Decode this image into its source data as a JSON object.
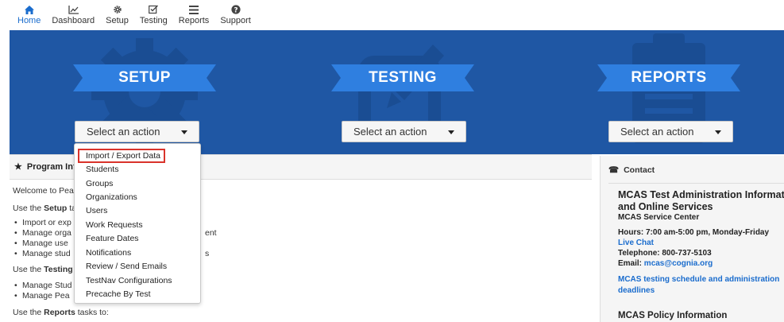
{
  "nav": {
    "items": [
      {
        "label": "Home",
        "icon": "home-icon"
      },
      {
        "label": "Dashboard",
        "icon": "chart-icon"
      },
      {
        "label": "Setup",
        "icon": "gear-icon"
      },
      {
        "label": "Testing",
        "icon": "checkbox-icon"
      },
      {
        "label": "Reports",
        "icon": "report-icon"
      },
      {
        "label": "Support",
        "icon": "help-icon"
      }
    ]
  },
  "banner": {
    "color": "#1f57a4",
    "ribbon_color": "#2f7fe0",
    "sections": [
      {
        "title": "SETUP",
        "select_label": "Select an action",
        "icon": "gear-icon"
      },
      {
        "title": "TESTING",
        "select_label": "Select an action",
        "icon": "edit-icon"
      },
      {
        "title": "REPORTS",
        "select_label": "Select an action",
        "icon": "clipboard-icon"
      }
    ]
  },
  "menu": {
    "items": [
      "Import / Export Data",
      "Students",
      "Groups",
      "Organizations",
      "Users",
      "Work Requests",
      "Feature Dates",
      "Notifications",
      "Review / Send Emails",
      "TestNav Configurations",
      "Precache By Test"
    ],
    "highlight_color": "#d9332b"
  },
  "program": {
    "heading": "Program Inf",
    "welcome": "Welcome to Pea",
    "setup_pre": "Use the ",
    "setup_bold": "Setup",
    "setup_post": " ta",
    "setup_bullets": [
      "Import or exp",
      "Manage orga",
      "Manage use",
      "Manage stud"
    ],
    "setup_tail_1": "ent",
    "setup_tail_3": "s",
    "testing_pre": "Use the ",
    "testing_bold": "Testing",
    "testing_bullets": [
      "Manage Stud",
      "Manage Pea"
    ],
    "reports_pre": "Use the ",
    "reports_bold": "Reports",
    "reports_post": " tasks to:"
  },
  "contact": {
    "heading": "Contact",
    "title_line1": "MCAS Test Administration Information",
    "title_line2": "and Online Services",
    "center": "MCAS Service Center",
    "hours": "Hours: 7:00 am-5:00 pm, Monday-Friday",
    "live_chat": "Live Chat",
    "telephone": "Telephone: 800-737-5103",
    "email_label": "Email: ",
    "email": "mcas@cognia.org",
    "schedule_link": "MCAS testing schedule and administration deadlines",
    "policy": "MCAS Policy Information",
    "link_color": "#1a6ccd"
  }
}
